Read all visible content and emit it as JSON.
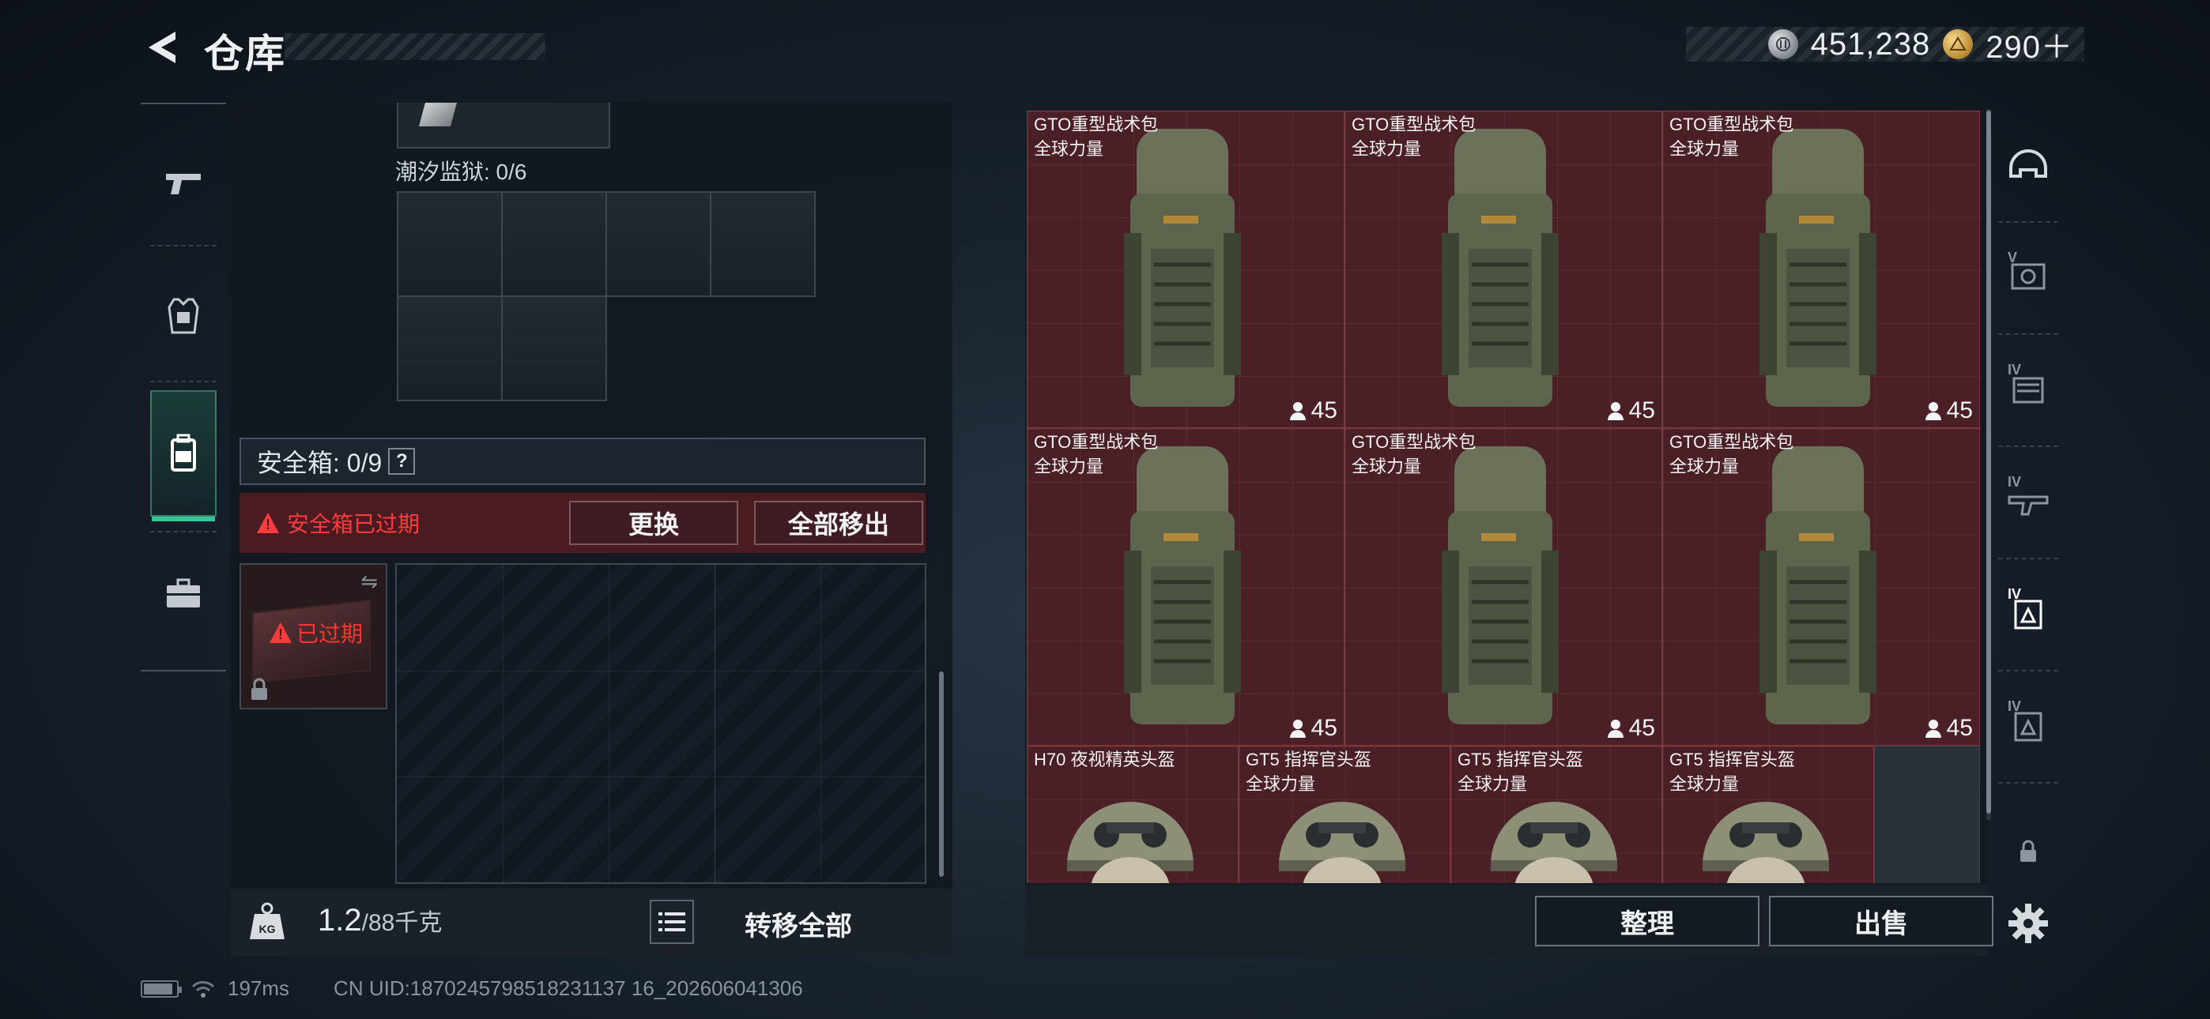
{
  "header": {
    "title": "仓库",
    "currencies": [
      {
        "icon": "silver-coin-icon",
        "value": "451,238"
      },
      {
        "icon": "gold-coin-icon",
        "value": "290＋"
      }
    ]
  },
  "left_rail": {
    "items": [
      {
        "name": "weapons",
        "icon": "pistol-icon"
      },
      {
        "name": "armor",
        "icon": "vest-icon"
      },
      {
        "name": "backpack",
        "icon": "backpack-icon",
        "active": true
      },
      {
        "name": "supplies",
        "icon": "briefcase-icon"
      }
    ]
  },
  "container": {
    "tide_label": "潮汐监狱: 0/6",
    "safe_box": {
      "label": "安全箱: 0/9",
      "help": "?",
      "expired_text": "安全箱已过期",
      "replace_label": "更换",
      "remove_all_label": "全部移出",
      "case_status": "已过期"
    },
    "weight": {
      "value": "1.2",
      "unit": "/88千克"
    },
    "transfer_all_label": "转移全部"
  },
  "storage": {
    "items": [
      {
        "name": "GTO重型战术包",
        "sub": "全球力量",
        "durability": "45",
        "type": "backpack"
      },
      {
        "name": "GTO重型战术包",
        "sub": "全球力量",
        "durability": "45",
        "type": "backpack"
      },
      {
        "name": "GTO重型战术包",
        "sub": "全球力量",
        "durability": "45",
        "type": "backpack"
      },
      {
        "name": "GTO重型战术包",
        "sub": "全球力量",
        "durability": "45",
        "type": "backpack"
      },
      {
        "name": "GTO重型战术包",
        "sub": "全球力量",
        "durability": "45",
        "type": "backpack"
      },
      {
        "name": "GTO重型战术包",
        "sub": "全球力量",
        "durability": "45",
        "type": "backpack"
      },
      {
        "name": "H70 夜视精英头盔",
        "sub": "",
        "type": "helmet"
      },
      {
        "name": "GT5 指挥官头盔",
        "sub": "全球力量",
        "type": "helmet"
      },
      {
        "name": "GT5 指挥官头盔",
        "sub": "全球力量",
        "type": "helmet"
      },
      {
        "name": "GT5 指挥官头盔",
        "sub": "全球力量",
        "type": "helmet"
      }
    ],
    "sort_label": "整理",
    "sell_label": "出售",
    "item_color": "#4b1f26"
  },
  "right_rail": {
    "filters": [
      {
        "icon": "helmet-filter-icon",
        "tier": ""
      },
      {
        "icon": "armor-filter-icon",
        "tier": "V"
      },
      {
        "icon": "chest-rig-filter-icon",
        "tier": "IV"
      },
      {
        "icon": "rifle-filter-icon",
        "tier": "IV"
      },
      {
        "icon": "backpack-filter-icon",
        "tier": "IV",
        "active": true
      },
      {
        "icon": "backpack-filter-icon",
        "tier": "IV"
      }
    ]
  },
  "status": {
    "ping": "197ms",
    "uid": "CN UID:1870245798518231137 16_202606041306"
  },
  "colors": {
    "accent": "#38c496",
    "warning": "#ff3b3b",
    "item_bg": "#4b1f26"
  }
}
